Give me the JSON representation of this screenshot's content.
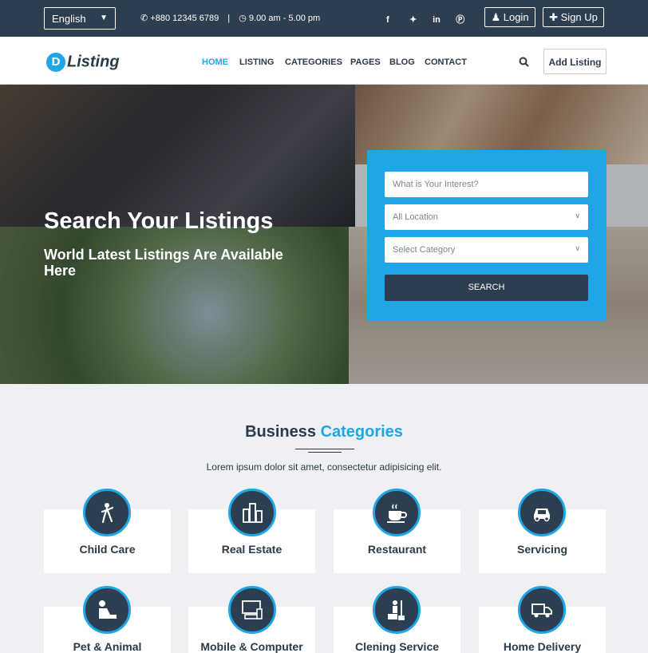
{
  "topbar": {
    "language": "English",
    "phone": "+880 12345 6789",
    "hours": "9.00 am - 5.00 pm",
    "social": [
      "facebook-icon",
      "twitter-icon",
      "linkedin-icon",
      "pinterest-icon"
    ],
    "login_label": "Login",
    "signup_label": "Sign Up"
  },
  "nav": {
    "logo_badge": "D",
    "logo_text": "Listing",
    "items": [
      "HOME",
      "LISTING",
      "CATEGORIES",
      "PAGES",
      "BLOG",
      "CONTACT"
    ],
    "active": "HOME",
    "add_listing_label": "Add Listing"
  },
  "hero": {
    "title": "Search Your Listings",
    "subtitle": "World Latest Listings Are Available Here"
  },
  "search": {
    "interest_placeholder": "What is Your Interest?",
    "location_value": "All Location",
    "category_value": "Select Category",
    "button_label": "SEARCH"
  },
  "categories": {
    "title_part1": "Business",
    "title_part2": "Categories",
    "description": "Lorem ipsum dolor sit amet, consectetur adipisicing elit.",
    "items": [
      {
        "label": "Child Care",
        "icon": "child-icon"
      },
      {
        "label": "Real Estate",
        "icon": "buildings-icon"
      },
      {
        "label": "Restaurant",
        "icon": "coffee-cup-icon"
      },
      {
        "label": "Servicing",
        "icon": "car-icon"
      },
      {
        "label": "Pet & Animal",
        "icon": "pet-icon"
      },
      {
        "label": "Mobile & Computer",
        "icon": "computer-icon"
      },
      {
        "label": "Clening Service",
        "icon": "cleaning-icon"
      },
      {
        "label": "Home Delivery",
        "icon": "truck-icon"
      }
    ]
  },
  "colors": {
    "accent": "#1ea6e6",
    "dark": "#2d3e50"
  }
}
